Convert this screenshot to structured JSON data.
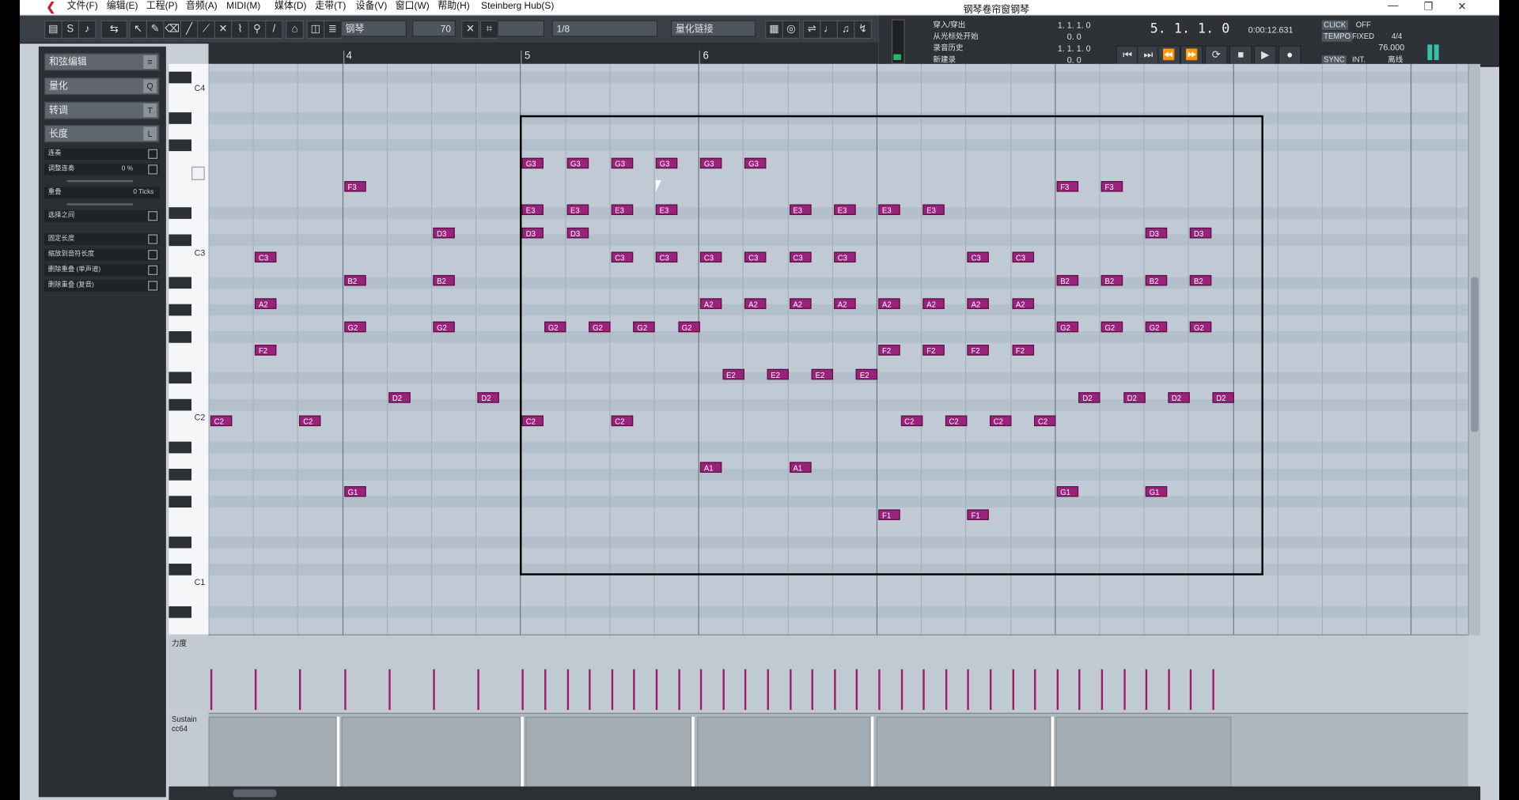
{
  "window": {
    "title": "钢琴卷帘窗钢琴",
    "menus": [
      "文件(F)",
      "编辑(E)",
      "工程(P)",
      "音频(A)",
      "MIDI(M)",
      "媒体(D)",
      "走带(T)",
      "设备(V)",
      "窗口(W)",
      "帮助(H)",
      "Steinberg Hub(S)"
    ],
    "controls": [
      "—",
      "❐",
      "✕"
    ]
  },
  "toolbar": {
    "instrument": "钢琴",
    "velocity_value": "70",
    "quantize_value": "1/8",
    "quantize_link": "量化链接",
    "ruler_numbers": [
      "4",
      "5",
      "6"
    ]
  },
  "transport": {
    "punch_in": "穿入/穿出",
    "from_start": "从光标处开始",
    "record_history": "录音历史",
    "new_mode": "新建录",
    "left_locator": "1. 1. 1.   0",
    "right_locator": "1. 1. 1.   0",
    "left_sub": "0.   0",
    "right_sub": "0.   0",
    "position": "5.  1.  1.    0",
    "time": "0:00:12.631",
    "click": "CLICK",
    "click_state": "OFF",
    "tempo_label": "TEMPO",
    "tempo_mode": "FIXED",
    "time_sig": "4/4",
    "tempo_value": "76.000",
    "sync": "SYNC",
    "sync_mode": "INT.",
    "sync_extra": "离线"
  },
  "left_panel": {
    "sections": [
      "和弦编辑",
      "量化",
      "转调",
      "长度"
    ],
    "section_keys": [
      "≡",
      "Q",
      "T",
      "L"
    ],
    "rows": [
      "连奏",
      "调整连奏",
      "重叠",
      "选择之间",
      "固定长度",
      "缩放到音符长度",
      "删除重叠 (单声道)",
      "删除重叠 (复音)"
    ],
    "legato_value": "0 %",
    "overlap_value": "0 Ticks"
  },
  "keyboard": {
    "labels": [
      "C4",
      "C3",
      "C2",
      "C1"
    ]
  },
  "notes": [
    {
      "pitch": "C2",
      "beat": 0
    },
    {
      "pitch": "C3",
      "beat": 1
    },
    {
      "pitch": "A2",
      "beat": 1
    },
    {
      "pitch": "F2",
      "beat": 1
    },
    {
      "pitch": "C2",
      "beat": 2
    },
    {
      "pitch": "F3",
      "beat": 3
    },
    {
      "pitch": "B2",
      "beat": 3
    },
    {
      "pitch": "G2",
      "beat": 3
    },
    {
      "pitch": "G1",
      "beat": 3
    },
    {
      "pitch": "D2",
      "beat": 4
    },
    {
      "pitch": "D3",
      "beat": 5
    },
    {
      "pitch": "B2",
      "beat": 5
    },
    {
      "pitch": "G2",
      "beat": 5
    },
    {
      "pitch": "D2",
      "beat": 6
    },
    {
      "pitch": "G3",
      "beat": 7
    },
    {
      "pitch": "E3",
      "beat": 7
    },
    {
      "pitch": "D3",
      "beat": 7
    },
    {
      "pitch": "C2",
      "beat": 7
    },
    {
      "pitch": "G2",
      "beat": 7.5
    },
    {
      "pitch": "G3",
      "beat": 8
    },
    {
      "pitch": "E3",
      "beat": 8
    },
    {
      "pitch": "D3",
      "beat": 8
    },
    {
      "pitch": "G2",
      "beat": 8.5
    },
    {
      "pitch": "G3",
      "beat": 9
    },
    {
      "pitch": "E3",
      "beat": 9
    },
    {
      "pitch": "C3",
      "beat": 9
    },
    {
      "pitch": "C2",
      "beat": 9
    },
    {
      "pitch": "G2",
      "beat": 9.5
    },
    {
      "pitch": "G3",
      "beat": 10
    },
    {
      "pitch": "E3",
      "beat": 10
    },
    {
      "pitch": "C3",
      "beat": 10
    },
    {
      "pitch": "G2",
      "beat": 10.5
    },
    {
      "pitch": "G3",
      "beat": 11
    },
    {
      "pitch": "C3",
      "beat": 11
    },
    {
      "pitch": "A2",
      "beat": 11
    },
    {
      "pitch": "A1",
      "beat": 11
    },
    {
      "pitch": "E2",
      "beat": 11.5
    },
    {
      "pitch": "G3",
      "beat": 12
    },
    {
      "pitch": "C3",
      "beat": 12
    },
    {
      "pitch": "A2",
      "beat": 12
    },
    {
      "pitch": "E2",
      "beat": 12.5
    },
    {
      "pitch": "E3",
      "beat": 13
    },
    {
      "pitch": "C3",
      "beat": 13
    },
    {
      "pitch": "A2",
      "beat": 13
    },
    {
      "pitch": "A1",
      "beat": 13
    },
    {
      "pitch": "E2",
      "beat": 13.5
    },
    {
      "pitch": "E3",
      "beat": 14
    },
    {
      "pitch": "C3",
      "beat": 14
    },
    {
      "pitch": "A2",
      "beat": 14
    },
    {
      "pitch": "E2",
      "beat": 14.5
    },
    {
      "pitch": "E3",
      "beat": 15
    },
    {
      "pitch": "A2",
      "beat": 15
    },
    {
      "pitch": "F2",
      "beat": 15
    },
    {
      "pitch": "F1",
      "beat": 15
    },
    {
      "pitch": "C2",
      "beat": 15.5
    },
    {
      "pitch": "E3",
      "beat": 16
    },
    {
      "pitch": "A2",
      "beat": 16
    },
    {
      "pitch": "F2",
      "beat": 16
    },
    {
      "pitch": "C2",
      "beat": 16.5
    },
    {
      "pitch": "C3",
      "beat": 17
    },
    {
      "pitch": "A2",
      "beat": 17
    },
    {
      "pitch": "F2",
      "beat": 17
    },
    {
      "pitch": "F1",
      "beat": 17
    },
    {
      "pitch": "C2",
      "beat": 17.5
    },
    {
      "pitch": "C3",
      "beat": 18
    },
    {
      "pitch": "A2",
      "beat": 18
    },
    {
      "pitch": "F2",
      "beat": 18
    },
    {
      "pitch": "C2",
      "beat": 18.5
    },
    {
      "pitch": "F3",
      "beat": 19
    },
    {
      "pitch": "B2",
      "beat": 19
    },
    {
      "pitch": "G2",
      "beat": 19
    },
    {
      "pitch": "G1",
      "beat": 19
    },
    {
      "pitch": "D2",
      "beat": 19.5
    },
    {
      "pitch": "F3",
      "beat": 20
    },
    {
      "pitch": "B2",
      "beat": 20
    },
    {
      "pitch": "G2",
      "beat": 20
    },
    {
      "pitch": "D2",
      "beat": 20.5
    },
    {
      "pitch": "D3",
      "beat": 21
    },
    {
      "pitch": "B2",
      "beat": 21
    },
    {
      "pitch": "G2",
      "beat": 21
    },
    {
      "pitch": "G1",
      "beat": 21
    },
    {
      "pitch": "D2",
      "beat": 21.5
    },
    {
      "pitch": "D3",
      "beat": 22
    },
    {
      "pitch": "B2",
      "beat": 22
    },
    {
      "pitch": "G2",
      "beat": 22
    },
    {
      "pitch": "D2",
      "beat": 22.5
    }
  ],
  "lanes": {
    "velocity_label": "力度",
    "sustain_label": "Sustain",
    "sustain_sub": "cc64"
  },
  "colors": {
    "note": "#99237a",
    "grid": "#bfcad4",
    "selection": "#000000"
  }
}
